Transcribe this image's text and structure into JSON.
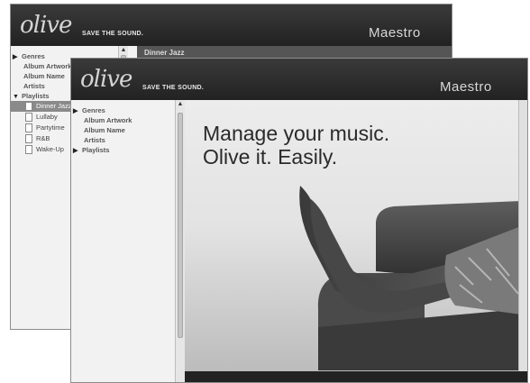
{
  "back_window": {
    "brand": "olive",
    "tagline": "SAVE THE SOUND.",
    "app_name": "Maestro",
    "header_text": "Dinner Jazz",
    "nav": {
      "genres": "Genres",
      "album_artwork": "Album Artwork",
      "album_name": "Album Name",
      "artists": "Artists",
      "playlists": "Playlists"
    },
    "playlists": [
      {
        "label": "Dinner Jazz",
        "selected": true
      },
      {
        "label": "Lullaby",
        "selected": false
      },
      {
        "label": "Partytime",
        "selected": false
      },
      {
        "label": "R&B",
        "selected": false
      },
      {
        "label": "Wake-Up",
        "selected": false
      }
    ]
  },
  "front_window": {
    "brand": "olive",
    "tagline": "SAVE THE SOUND.",
    "app_name": "Maestro",
    "nav": {
      "genres": "Genres",
      "album_artwork": "Album Artwork",
      "album_name": "Album Name",
      "artists": "Artists",
      "playlists": "Playlists"
    },
    "hero": {
      "line1": "Manage your music.",
      "line2": "Olive it. Easily."
    }
  }
}
